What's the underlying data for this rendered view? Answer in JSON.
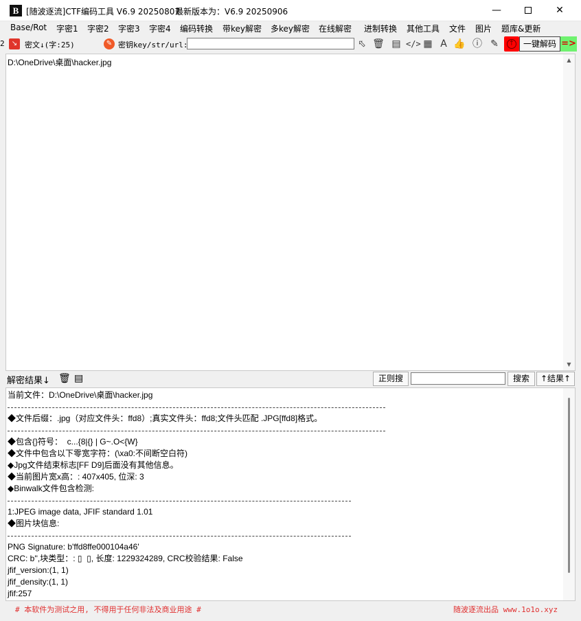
{
  "window": {
    "title": "[随波逐流]CTF编码工具 V6.9 20250807",
    "latest_version": "最新版本为：V6.9  20250906",
    "logo_text": "B"
  },
  "menu": [
    "Base/Rot",
    "字密1",
    "字密2",
    "字密3",
    "字密4",
    "编码转换",
    "带key解密",
    "多key解密",
    "在线解密",
    "进制转换",
    "其他工具",
    "文件",
    "图片",
    "题库&更新"
  ],
  "toolbar": {
    "left_edge": "2",
    "cipher_label": "密文↓(字:25)",
    "key_label": "密钥key/str/url:",
    "key_value": "",
    "decode_button": "一键解码",
    "arrow_button": "=>"
  },
  "cipher": {
    "text": "D:\\OneDrive\\桌面\\hacker.jpg"
  },
  "result_bar": {
    "label": "解密结果↓",
    "regex_button": "正则搜",
    "search_value": "",
    "search_button": "搜索",
    "result_up_button": "↑结果↑"
  },
  "result": {
    "lines": [
      "当前文件：D:\\OneDrive\\桌面\\hacker.jpg",
      "",
      "◆文件后缀：.jpg（对应文件头：ffd8）;真实文件头：ffd8;文件头匹配 .JPG[ffd8]格式。",
      "",
      "◆包含{}符号：  c...{8|{} | G~.O<{W}",
      "◆文件中包含以下零宽字符：(\\xa0:不间断空白符)",
      "◆Jpg文件结束标志[FF D9]后面没有其他信息。",
      "◆当前图片宽x高：: 407x405, 位深: 3",
      "◆Binwalk文件包含检测:",
      "",
      "1:JPEG image data, JFIF standard 1.01",
      "◆图片块信息:",
      "",
      "PNG Signature: b'ffd8ffe000104a46'",
      "CRC: b'',块类型：: ▯  ▯, 长度: 1229324289, CRC校验结果: False",
      "jfif_version:(1, 1)",
      "jfif_density:(1, 1)",
      "jfif:257"
    ],
    "separators": [
      1,
      3,
      9,
      12
    ]
  },
  "status": {
    "left": "# 本软件为测试之用, 不得用于任何非法及商业用途 #",
    "right": "随波逐流出品 www.1o1o.xyz"
  }
}
